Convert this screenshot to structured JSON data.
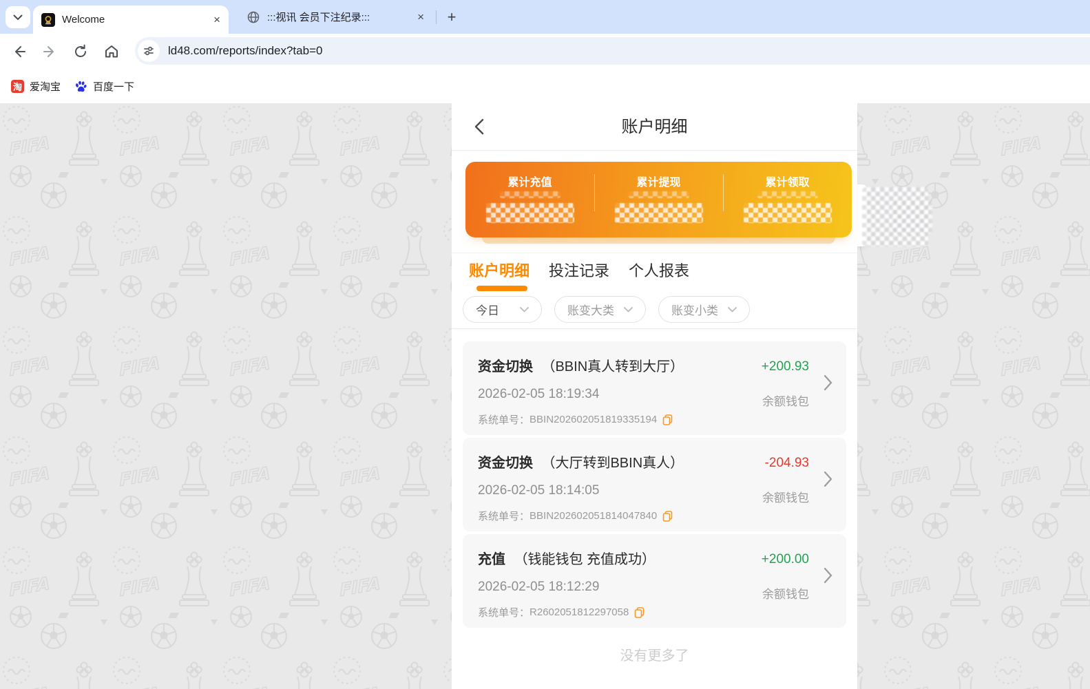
{
  "browser": {
    "tabs": [
      {
        "title": "Welcome",
        "active": true
      },
      {
        "title": ":::视讯 会员下注纪录:::",
        "active": false
      }
    ],
    "tab_close_glyph": "×",
    "new_tab_glyph": "+",
    "url": "ld48.com/reports/index?tab=0",
    "bookmarks": [
      {
        "label": "爱淘宝",
        "icon_glyph": "淘"
      },
      {
        "label": "百度一下"
      }
    ]
  },
  "page": {
    "header_title": "账户明细",
    "summary": {
      "items": [
        {
          "label": "累计充值",
          "value_hidden": true
        },
        {
          "label": "累计提现",
          "value_hidden": true
        },
        {
          "label": "累计领取",
          "value_hidden": true
        }
      ]
    },
    "tabs": [
      {
        "label": "账户明细",
        "active": true
      },
      {
        "label": "投注记录",
        "active": false
      },
      {
        "label": "个人报表",
        "active": false
      }
    ],
    "filters": [
      {
        "label": "今日"
      },
      {
        "label": "账变大类"
      },
      {
        "label": "账变小类"
      }
    ],
    "order_label": "系统单号：",
    "transactions": [
      {
        "type": "资金切换",
        "subtitle": "（BBIN真人转到大厅）",
        "datetime": "2026-02-05 18:19:34",
        "order_no": "BBIN202602051819335194",
        "amount": "+200.93",
        "wallet": "余额钱包",
        "direction": "positive"
      },
      {
        "type": "资金切换",
        "subtitle": "（大厅转到BBIN真人）",
        "datetime": "2026-02-05 18:14:05",
        "order_no": "BBIN202602051814047840",
        "amount": "-204.93",
        "wallet": "余额钱包",
        "direction": "negative"
      },
      {
        "type": "充值",
        "subtitle": "（钱能钱包 充值成功）",
        "datetime": "2026-02-05 18:12:29",
        "order_no": "R2602051812297058",
        "amount": "+200.00",
        "wallet": "余额钱包",
        "direction": "positive"
      }
    ],
    "footer": "没有更多了"
  },
  "colors": {
    "accent_orange": "#ff8a00",
    "card_gradient_start": "#f1701c",
    "card_gradient_end": "#f6c41b",
    "positive": "#21a350",
    "negative": "#e5392e",
    "tabstrip_bg": "#d3e2fc"
  }
}
